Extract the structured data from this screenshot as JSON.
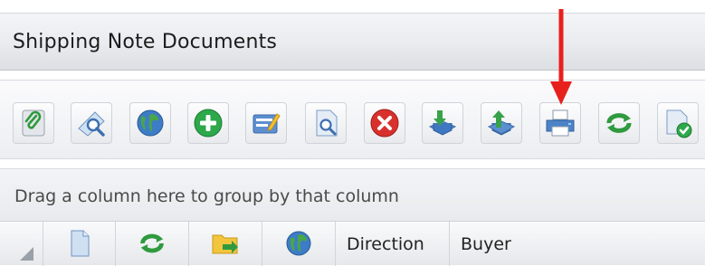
{
  "window": {
    "title": "Shipping Note Documents"
  },
  "toolbar": {
    "buttons": [
      {
        "name": "attach-icon"
      },
      {
        "name": "preview-icon"
      },
      {
        "name": "globe-icon"
      },
      {
        "name": "add-icon"
      },
      {
        "name": "edit-icon"
      },
      {
        "name": "search-document-icon"
      },
      {
        "name": "delete-icon"
      },
      {
        "name": "import-icon"
      },
      {
        "name": "export-icon"
      },
      {
        "name": "print-icon"
      },
      {
        "name": "refresh-icon"
      },
      {
        "name": "document-approve-icon"
      }
    ],
    "highlight_color": "#e8201c"
  },
  "grid": {
    "group_panel_text": "Drag a column here to group by that column",
    "columns": {
      "direction": "Direction",
      "buyer": "Buyer"
    },
    "column_icons": [
      "document-icon",
      "refresh-icon",
      "folder-icon",
      "globe-icon"
    ]
  }
}
